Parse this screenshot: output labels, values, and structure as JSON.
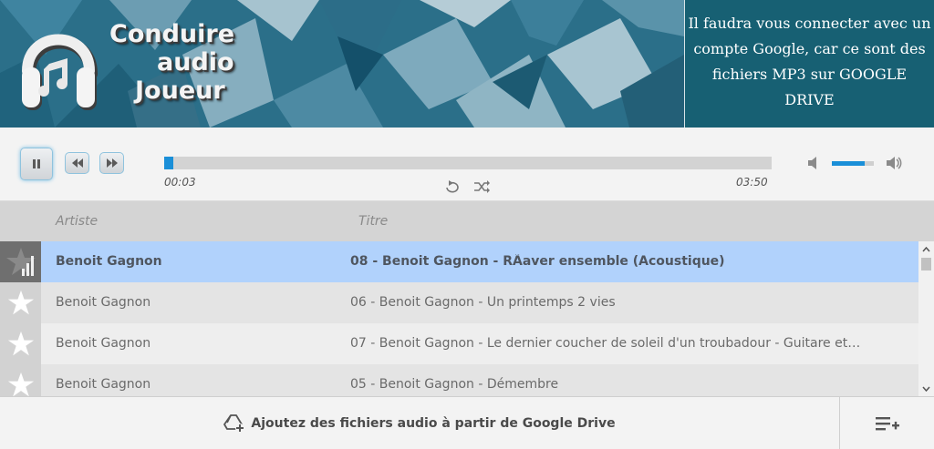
{
  "app": {
    "logo_lines": [
      "Conduire",
      "audio",
      "Joueur"
    ],
    "notice": "Il faudra vous connecter avec un compte Google, car ce sont des fichiers MP3 sur GOOGLE DRIVE"
  },
  "player": {
    "state": "playing",
    "current_time": "00:03",
    "duration": "03:50",
    "progress_fraction": 0.015,
    "volume_fraction": 0.78
  },
  "icons": {
    "pause": "pause-icon",
    "prev": "rewind-icon",
    "next": "fast-forward-icon",
    "repeat": "repeat-icon",
    "shuffle": "shuffle-icon",
    "mute": "volume-mute-icon",
    "volume": "volume-up-icon",
    "add_drive": "google-drive-add-icon",
    "queue": "playlist-add-icon"
  },
  "table": {
    "columns": {
      "artist": "Artiste",
      "title": "Titre"
    },
    "rows": [
      {
        "artist": "Benoit Gagnon",
        "title": "08 - Benoit Gagnon - RÃaver ensemble (Acoustique)",
        "active": true
      },
      {
        "artist": "Benoit Gagnon",
        "title": "06 - Benoit Gagnon - Un printemps 2 vies",
        "active": false
      },
      {
        "artist": "Benoit Gagnon",
        "title": "07 - Benoit Gagnon - Le dernier coucher de soleil d'un troubadour - Guitare et…",
        "active": false
      },
      {
        "artist": "Benoit Gagnon",
        "title": "05 - Benoit Gagnon - Démembre",
        "active": false
      }
    ]
  },
  "footer": {
    "add_label": "Ajoutez des fichiers audio à partir de Google Drive"
  },
  "colors": {
    "accent": "#1a8fd8",
    "active_row": "#b1d2fc",
    "banner": "#2a6e88",
    "notice_bg": "#176073"
  }
}
